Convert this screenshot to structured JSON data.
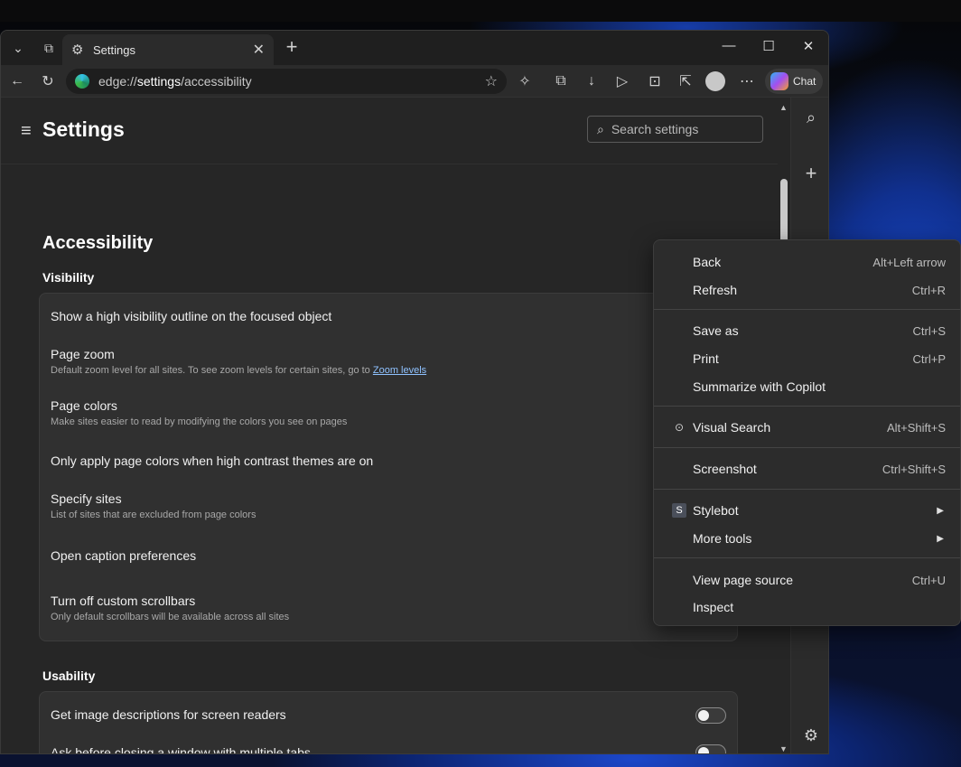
{
  "tab": {
    "title": "Settings"
  },
  "address": {
    "prefix": "edge://",
    "bold": "settings",
    "suffix": "/accessibility"
  },
  "toolbar": {
    "chat_label": "Chat"
  },
  "settings": {
    "title": "Settings",
    "search_placeholder": "Search settings",
    "page_title": "Accessibility",
    "visibility_heading": "Visibility",
    "usability_heading": "Usability",
    "visibility_rows": [
      {
        "title": "Show a high visibility outline on the focused object"
      },
      {
        "title": "Page zoom",
        "sub": "Default zoom level for all sites. To see zoom levels for certain sites, go to ",
        "link": "Zoom levels"
      },
      {
        "title": "Page colors",
        "sub": "Make sites easier to read by modifying the colors you see on pages"
      },
      {
        "title": "Only apply page colors when high contrast themes are on"
      },
      {
        "title": "Specify sites",
        "sub": "List of sites that are excluded from page colors"
      },
      {
        "title": "Open caption preferences"
      },
      {
        "title": "Turn off custom scrollbars",
        "sub": "Only default scrollbars will be available across all sites"
      }
    ],
    "usability_rows": [
      {
        "title": "Get image descriptions for screen readers"
      },
      {
        "title": "Ask before closing a window with multiple tabs"
      }
    ]
  },
  "context_menu": {
    "items": [
      {
        "label": "Back",
        "shortcut": "Alt+Left arrow"
      },
      {
        "label": "Refresh",
        "shortcut": "Ctrl+R"
      },
      {
        "label": "Save as",
        "shortcut": "Ctrl+S"
      },
      {
        "label": "Print",
        "shortcut": "Ctrl+P"
      },
      {
        "label": "Summarize with Copilot",
        "shortcut": ""
      },
      {
        "label": "Visual Search",
        "shortcut": "Alt+Shift+S",
        "icon": "visual-search-icon"
      },
      {
        "label": "Screenshot",
        "shortcut": "Ctrl+Shift+S"
      },
      {
        "label": "Stylebot",
        "shortcut": "",
        "icon": "stylebot-icon",
        "icon_text": "S",
        "submenu": true
      },
      {
        "label": "More tools",
        "shortcut": "",
        "submenu": true
      },
      {
        "label": "View page source",
        "shortcut": "Ctrl+U"
      },
      {
        "label": "Inspect",
        "shortcut": ""
      }
    ]
  }
}
